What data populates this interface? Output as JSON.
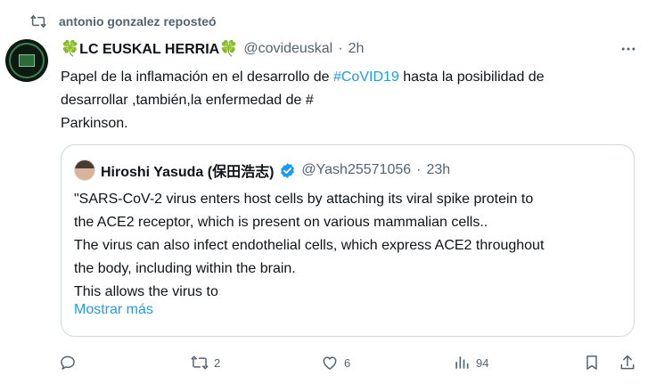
{
  "repost": {
    "text": "antonio gonzalez reposteó"
  },
  "tweet": {
    "clover": "🍀",
    "name_text": "LC EUSKAL HERRIA",
    "handle": "@covideuskal",
    "dot": "·",
    "time": "2h",
    "text_part1": "Papel de la inflamación en el desarrollo de ",
    "hashtag": "#CoVID19",
    "text_part2": " hasta la posibilidad de\ndesarrollar ,también,la enfermedad de #\nParkinson."
  },
  "quote": {
    "name": "Hiroshi Yasuda (保田浩志)",
    "handle": "@Yash25571056",
    "dot": "·",
    "time": "23h",
    "text": "\"SARS-CoV-2 virus enters host cells by attaching its viral spike protein to\nthe ACE2 receptor, which is present on various mammalian cells..\nThe virus can also infect endothelial cells, which express ACE2 throughout\nthe body, including within the brain.\nThis allows the virus to",
    "show_more": "Mostrar más"
  },
  "actions": {
    "reposts": "2",
    "likes": "6",
    "views": "94"
  },
  "colors": {
    "accent": "#1d9bf0",
    "secondary": "#536471",
    "border": "#cfd9de",
    "clover": "#2e8b3a"
  },
  "icons": [
    "repost-icon",
    "more-icon",
    "verified-badge-icon",
    "reply-icon",
    "like-icon",
    "views-icon",
    "bookmark-icon",
    "share-icon"
  ]
}
